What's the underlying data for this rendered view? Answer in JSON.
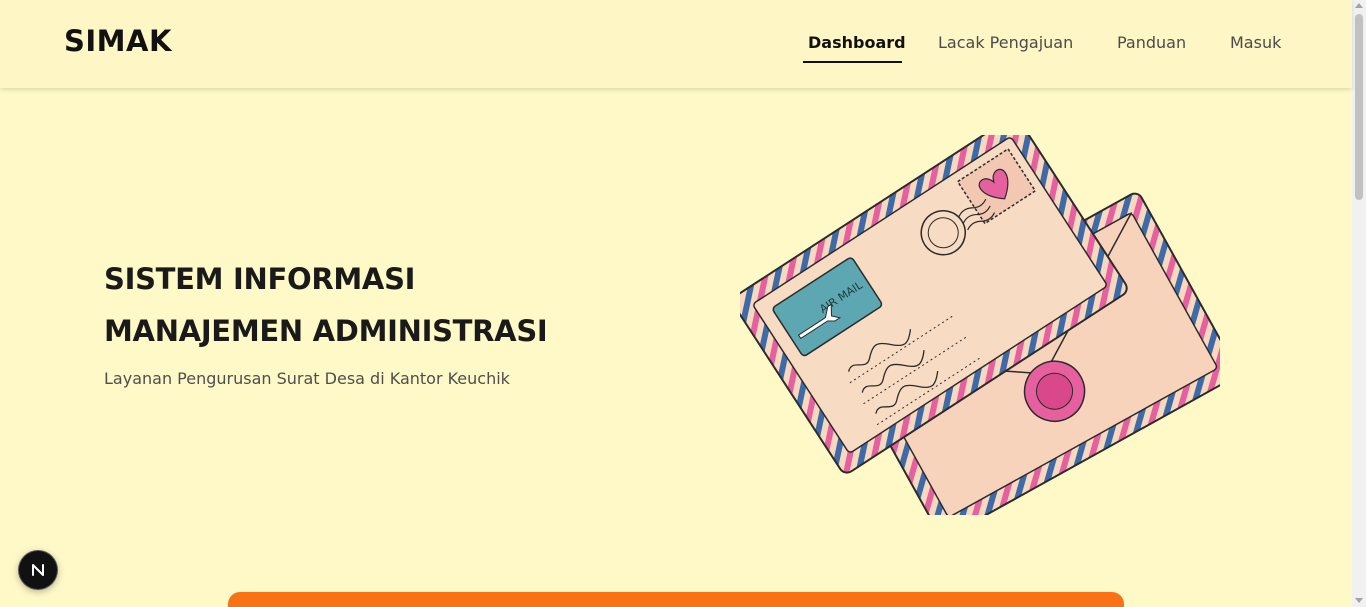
{
  "brand": "SIMAK",
  "nav": {
    "items": [
      {
        "label": "Dashboard",
        "active": true
      },
      {
        "label": "Lacak Pengajuan",
        "active": false
      },
      {
        "label": "Panduan",
        "active": false
      },
      {
        "label": "Masuk",
        "active": false
      }
    ]
  },
  "hero": {
    "title_line1": "SISTEM INFORMASI",
    "title_line2": "MANAJEMEN ADMINISTRASI",
    "subtitle": "Layanan Pengurusan Surat Desa di Kantor Keuchik",
    "illustration_icon": "air-mail-envelope-icon",
    "stamp_text": "AIR MAIL"
  },
  "devtools": {
    "badge_icon": "nextjs-n-icon"
  },
  "colors": {
    "background": "#fef9c7",
    "navbar": "#fef6c4",
    "accent_orange": "#f97316",
    "envelope_pink": "#e65f9e",
    "envelope_blue": "#3f6aa8",
    "envelope_body": "#f7d9c0",
    "stamp_teal": "#5ca7b1"
  }
}
